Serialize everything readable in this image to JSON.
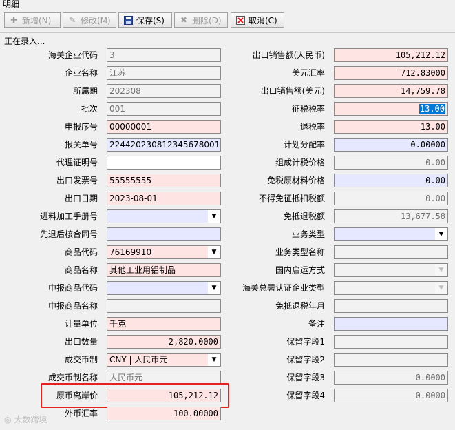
{
  "window": {
    "title": "明细"
  },
  "toolbar": {
    "add": "新增(N)",
    "edit": "修改(M)",
    "save": "保存(S)",
    "delete": "删除(D)",
    "cancel": "取消(C)"
  },
  "status": "正在录入...",
  "left": {
    "customs_code": {
      "label": "海关企业代码",
      "value": "3"
    },
    "company_name": {
      "label": "企业名称",
      "value": "江苏"
    },
    "period": {
      "label": "所属期",
      "value": "202308"
    },
    "batch": {
      "label": "批次",
      "value": "001"
    },
    "decl_seq": {
      "label": "申报序号",
      "value": "00000001"
    },
    "customs_decl_no": {
      "label": "报关单号",
      "value": "224420230812345678001"
    },
    "agent_cert_no": {
      "label": "代理证明号",
      "value": ""
    },
    "invoice_no": {
      "label": "出口发票号",
      "value": "55555555"
    },
    "export_date": {
      "label": "出口日期",
      "value": "2023-08-01"
    },
    "processing_manual": {
      "label": "进料加工手册号",
      "value": ""
    },
    "refund_contract": {
      "label": "先退后核合同号",
      "value": ""
    },
    "product_code": {
      "label": "商品代码",
      "value": "76169910"
    },
    "product_name": {
      "label": "商品名称",
      "value": "其他工业用铝制品"
    },
    "decl_product_code": {
      "label": "申报商品代码",
      "value": ""
    },
    "decl_product_name": {
      "label": "申报商品名称",
      "value": ""
    },
    "unit": {
      "label": "计量单位",
      "value": "千克"
    },
    "export_qty": {
      "label": "出口数量",
      "value": "2,820.0000"
    },
    "currency": {
      "label": "成交币制",
      "value": "CNY | 人民币元"
    },
    "currency_name": {
      "label": "成交币制名称",
      "value": "人民币元"
    },
    "fob_price": {
      "label": "原币离岸价",
      "value": "105,212.12"
    },
    "fx_rate": {
      "label": "外币汇率",
      "value": "100.00000"
    }
  },
  "right": {
    "sales_cny": {
      "label": "出口销售额(人民币)",
      "value": "105,212.12"
    },
    "usd_rate": {
      "label": "美元汇率",
      "value": "712.83000"
    },
    "sales_usd": {
      "label": "出口销售额(美元)",
      "value": "14,759.78"
    },
    "levy_rate": {
      "label": "征税税率",
      "value": "13.00"
    },
    "refund_rate": {
      "label": "退税率",
      "value": "13.00"
    },
    "alloc_rate": {
      "label": "计划分配率",
      "value": "0.00000"
    },
    "composite_price": {
      "label": "组成计税价格",
      "value": "0.00"
    },
    "exempt_material": {
      "label": "免税原材料价格",
      "value": "0.00"
    },
    "non_deductible": {
      "label": "不得免征抵扣税额",
      "value": "0.00"
    },
    "exempt_refund": {
      "label": "免抵退税额",
      "value": "13,677.58"
    },
    "biz_type": {
      "label": "业务类型",
      "value": ""
    },
    "biz_type_name": {
      "label": "业务类型名称",
      "value": ""
    },
    "shipment_mode": {
      "label": "国内启运方式",
      "value": ""
    },
    "customs_cert_type": {
      "label": "海关总署认证企业类型",
      "value": ""
    },
    "refund_month": {
      "label": "免抵退税年月",
      "value": ""
    },
    "remark": {
      "label": "备注",
      "value": ""
    },
    "reserve1": {
      "label": "保留字段1",
      "value": ""
    },
    "reserve2": {
      "label": "保留字段2",
      "value": ""
    },
    "reserve3": {
      "label": "保留字段3",
      "value": "0.0000"
    },
    "reserve4": {
      "label": "保留字段4",
      "value": "0.0000"
    }
  },
  "watermark": "大数跨境",
  "colors": {
    "highlight_box": "#e52222",
    "required": "#ffe4e4",
    "optional": "#e6e8ff",
    "selection": "#0078d7"
  }
}
